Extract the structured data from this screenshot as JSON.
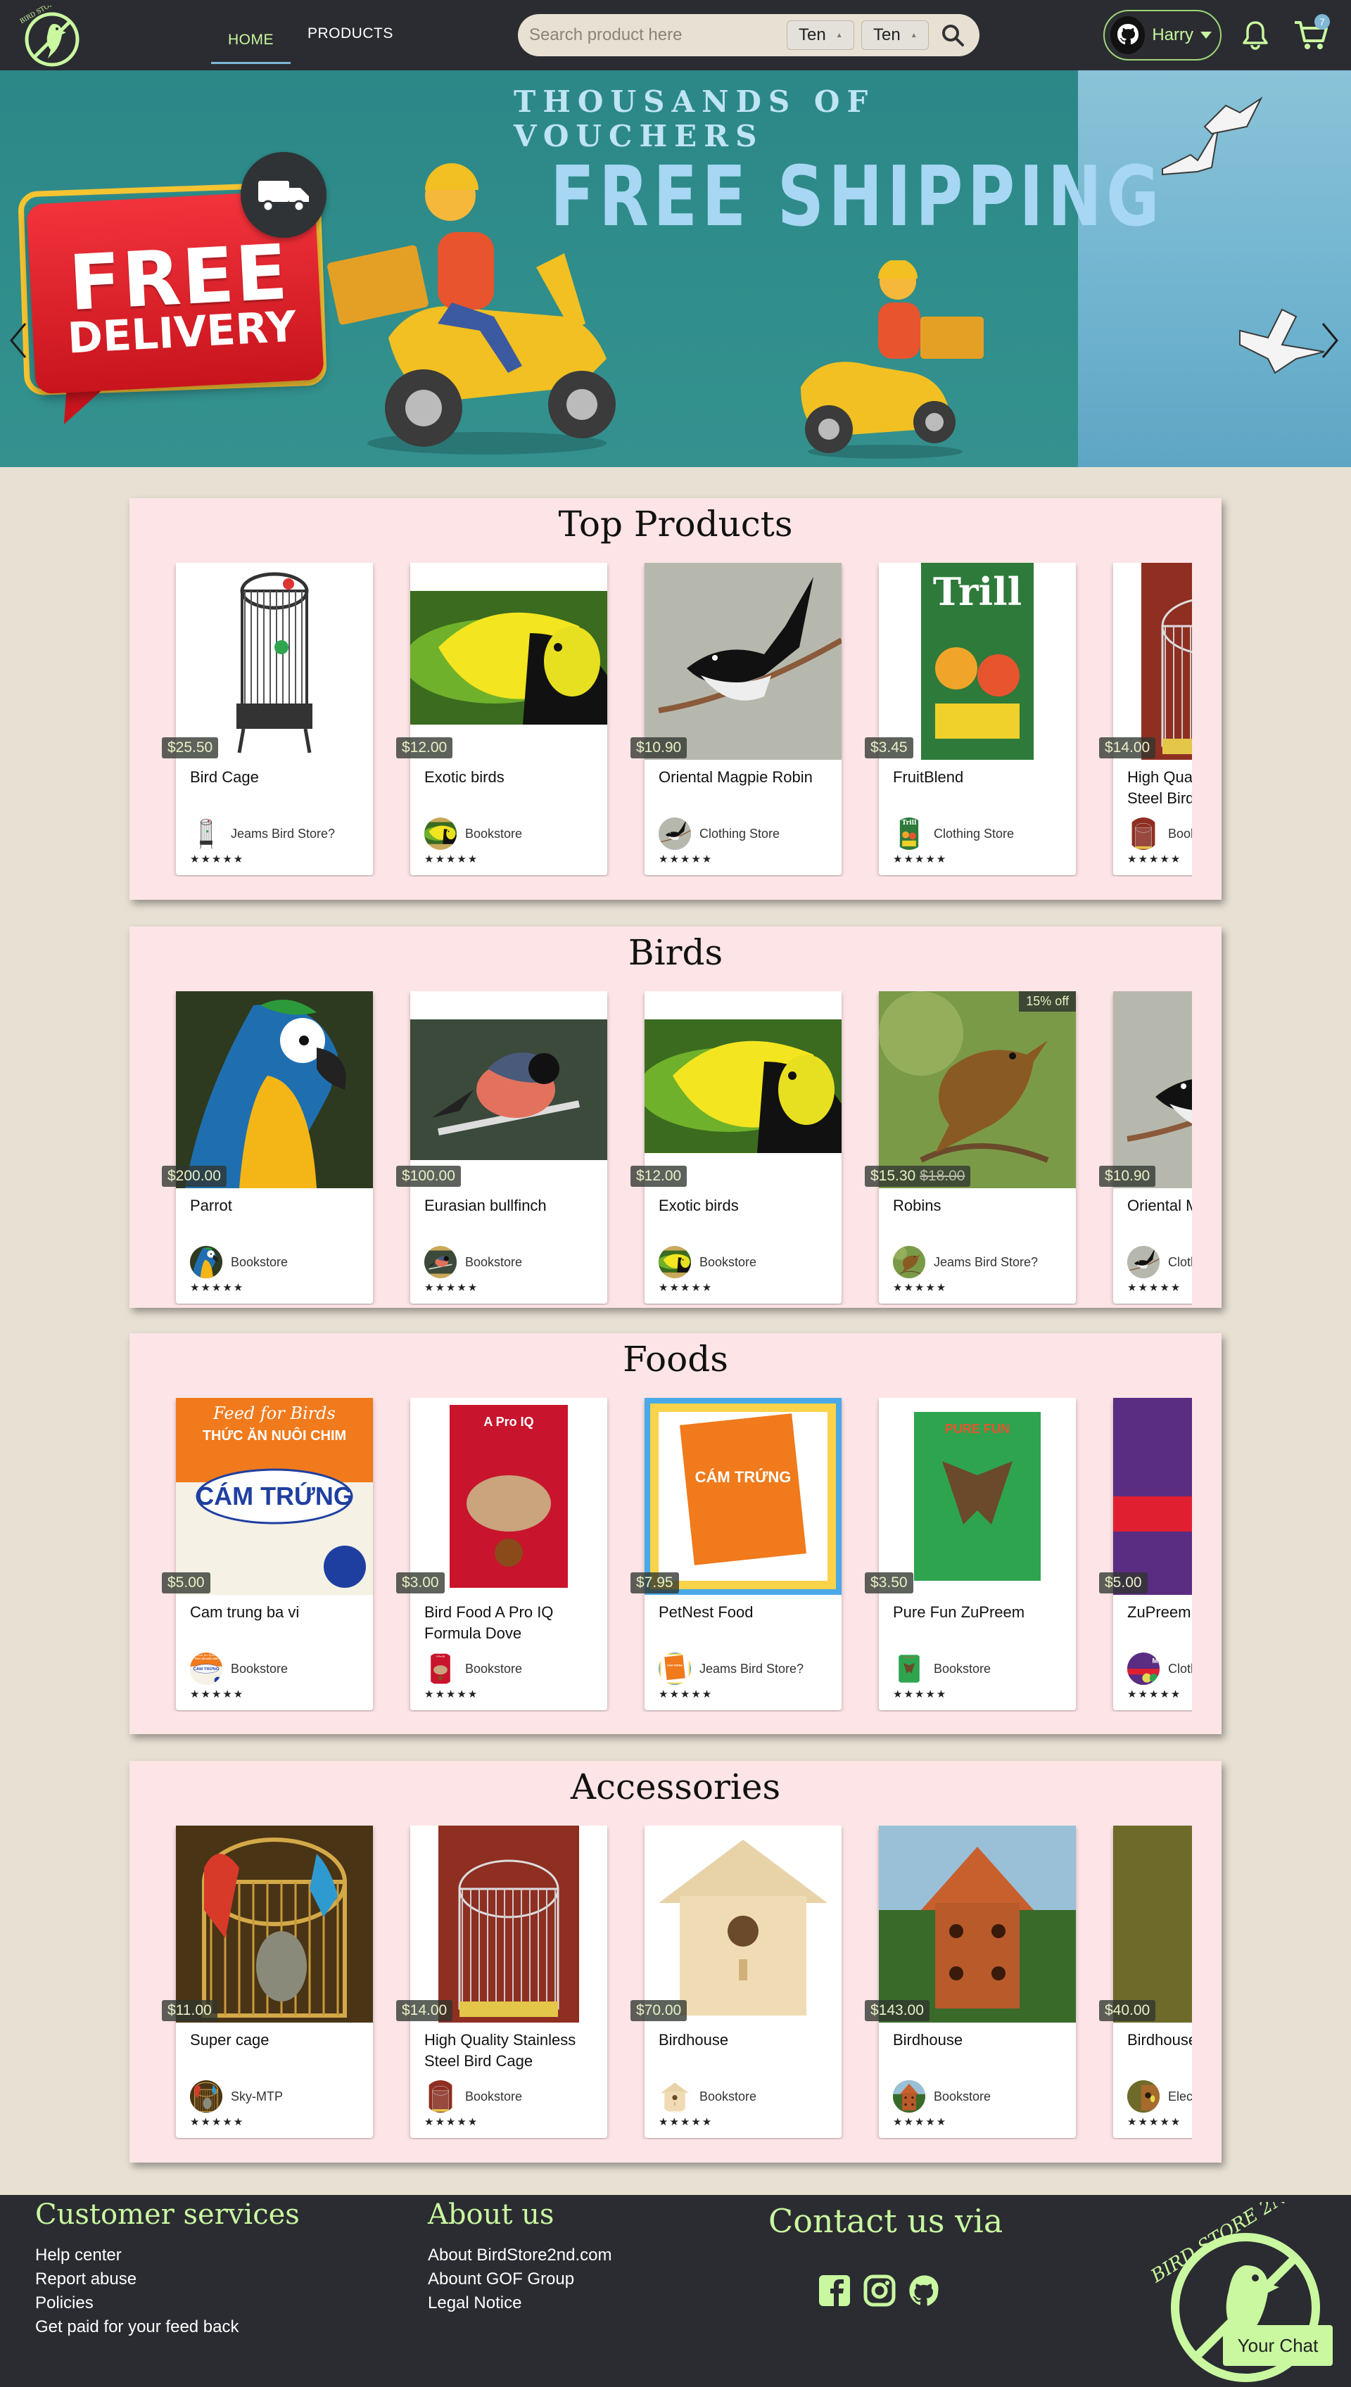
{
  "header": {
    "logo_text": "BIRD STORE 2ND",
    "nav": [
      {
        "label": "HOME",
        "active": true
      },
      {
        "label": "PRODUCTS",
        "active": false
      }
    ],
    "search": {
      "placeholder": "Search product here",
      "select1": "Ten",
      "select2": "Ten"
    },
    "user": {
      "name": "Harry"
    },
    "cart_count": "7",
    "icons": {
      "search": "search-icon",
      "bell": "bell-icon",
      "cart": "cart-icon",
      "avatar": "github-cat-icon"
    }
  },
  "banner": {
    "kicker": "THOUSANDS OF VOUCHERS",
    "headline": "FREE SHIPPING",
    "badge_line1": "FREE",
    "badge_line2": "DELIVERY",
    "slides": 5,
    "active_slide": 2
  },
  "sections": [
    {
      "title": "Top Products",
      "products": [
        {
          "name": "Bird Cage",
          "price": "$25.50",
          "store": "Jeams Bird Store?",
          "img": "cage"
        },
        {
          "name": "Exotic birds",
          "price": "$12.00",
          "store": "Bookstore",
          "img": "toucan"
        },
        {
          "name": "Oriental Magpie Robin",
          "price": "$10.90",
          "store": "Clothing Store",
          "img": "magpie"
        },
        {
          "name": "FruitBlend",
          "price": "$3.45",
          "store": "Clothing Store",
          "img": "trill"
        },
        {
          "name": "High Quality Stainless Steel Bird Cage",
          "price": "$14.00",
          "store": "Bookstore",
          "img": "steelcage"
        }
      ]
    },
    {
      "title": "Birds",
      "products": [
        {
          "name": "Parrot",
          "price": "$200.00",
          "store": "Bookstore",
          "img": "parrot"
        },
        {
          "name": "Eurasian bullfinch",
          "price": "$100.00",
          "store": "Bookstore",
          "img": "bullfinch"
        },
        {
          "name": "Exotic birds",
          "price": "$12.00",
          "store": "Bookstore",
          "img": "toucan"
        },
        {
          "name": "Robins",
          "price": "$15.30",
          "old_price": "$18.00",
          "discount": "15% off",
          "store": "Jeams Bird Store?",
          "img": "robin"
        },
        {
          "name": "Oriental Magpie Robin",
          "price": "$10.90",
          "store": "Clothing Store",
          "img": "magpie"
        }
      ]
    },
    {
      "title": "Foods",
      "products": [
        {
          "name": "Cam trung ba vi",
          "price": "$5.00",
          "store": "Bookstore",
          "img": "camtrung"
        },
        {
          "name": "Bird Food A Pro IQ Formula Dove",
          "price": "$3.00",
          "store": "Bookstore",
          "img": "dovefood"
        },
        {
          "name": "PetNest Food",
          "price": "$7.95",
          "store": "Jeams Bird Store?",
          "img": "petnest"
        },
        {
          "name": "Pure Fun ZuPreem",
          "price": "$3.50",
          "store": "Bookstore",
          "img": "purefun"
        },
        {
          "name": "ZuPreem Natural",
          "price": "$5.00",
          "store": "Clothing Store",
          "img": "zupreem"
        }
      ]
    },
    {
      "title": "Accessories",
      "products": [
        {
          "name": "Super cage",
          "price": "$11.00",
          "store": "Sky-MTP",
          "img": "supercage"
        },
        {
          "name": "High Quality Stainless Steel Bird Cage",
          "price": "$14.00",
          "store": "Bookstore",
          "img": "steelcage"
        },
        {
          "name": "Birdhouse",
          "price": "$70.00",
          "store": "Bookstore",
          "img": "woodhouse"
        },
        {
          "name": "Birdhouse",
          "price": "$143.00",
          "store": "Bookstore",
          "img": "redhouse"
        },
        {
          "name": "Birdhouse",
          "price": "$40.00",
          "store": "Electronics Store",
          "img": "greenhouse"
        }
      ]
    }
  ],
  "footer": {
    "customer_services": {
      "title": "Customer services",
      "links": [
        "Help center",
        "Report abuse",
        "Policies",
        "Get paid for your feed back"
      ]
    },
    "about": {
      "title": "About us",
      "links": [
        "About BirdStore2nd.com",
        "Abount GOF Group",
        "Legal Notice"
      ]
    },
    "contact": {
      "title": "Contact us via",
      "icons": [
        "facebook-icon",
        "instagram-icon",
        "github-icon"
      ]
    },
    "chat_label": "Your Chat"
  },
  "colors": {
    "header_bg": "#2b2c31",
    "accent_green": "#c9f8a0",
    "section_bg": "#fde4e6",
    "page_bg": "#e7e0d3"
  }
}
